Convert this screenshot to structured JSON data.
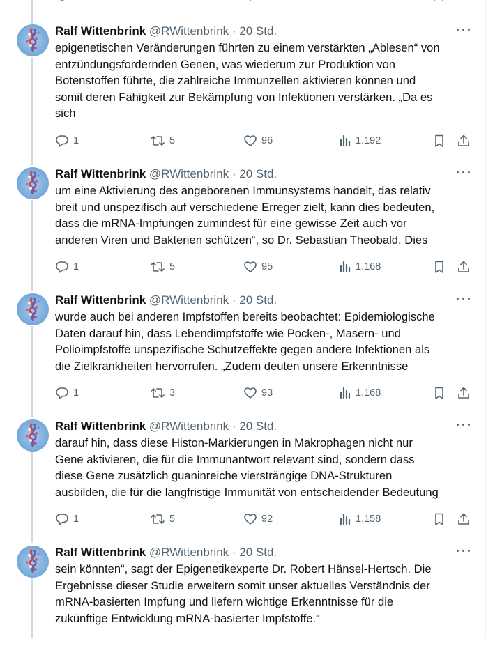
{
  "tweets": [
    {
      "author": "Ralf Wittenbrink",
      "handle": "@RWittenbrink",
      "time": "· 20 Std.",
      "lines": [
        "epigenetischen Veränderungen führten zu einem verstärkten „Ablesen“ von",
        "entzündungsfordernden Genen, was wiederum zur Produktion von",
        "Botenstoffen führte, die zahlreiche Immunzellen aktivieren können und",
        "somit deren Fähigkeit zur Bekämpfung von Infektionen verstärken. „Da es",
        "sich"
      ],
      "replies": "1",
      "reposts": "5",
      "likes": "96",
      "views": "1.192"
    },
    {
      "author": "Ralf Wittenbrink",
      "handle": "@RWittenbrink",
      "time": "· 20 Std.",
      "lines": [
        "um eine Aktivierung des angeborenen Immunsystems handelt, das relativ",
        "breit und unspezifisch auf verschiedene Erreger zielt, kann dies bedeuten,",
        "dass die mRNA-Impfungen zumindest für eine gewisse Zeit auch vor",
        "anderen Viren und Bakterien schützen“, so Dr. Sebastian Theobald. Dies"
      ],
      "replies": "1",
      "reposts": "5",
      "likes": "95",
      "views": "1.168"
    },
    {
      "author": "Ralf Wittenbrink",
      "handle": "@RWittenbrink",
      "time": "· 20 Std.",
      "lines": [
        "wurde auch bei anderen Impfstoffen bereits beobachtet: Epidemiologische",
        "Daten darauf hin, dass Lebendimpfstoffe wie Pocken-, Masern- und",
        "Polioimpfstoffe unspezifische Schutzeffekte gegen andere Infektionen als",
        "die Zielkrankheiten hervorrufen. „Zudem deuten unsere Erkenntnisse"
      ],
      "replies": "1",
      "reposts": "3",
      "likes": "93",
      "views": "1.168"
    },
    {
      "author": "Ralf Wittenbrink",
      "handle": "@RWittenbrink",
      "time": "· 20 Std.",
      "lines": [
        "darauf hin, dass diese Histon-Markierungen in Makrophagen nicht nur",
        "Gene aktivieren, die für die Immunantwort relevant sind, sondern dass",
        "diese Gene zusätzlich guaninreiche viersträngige DNA-Strukturen",
        "ausbilden, die für die langfristige Immunität von entscheidender Bedeutung"
      ],
      "replies": "1",
      "reposts": "5",
      "likes": "92",
      "views": "1.158"
    },
    {
      "author": "Ralf Wittenbrink",
      "handle": "@RWittenbrink",
      "time": "· 20 Std.",
      "lines": [
        "sein könnten“, sagt der Epigenetikexperte Dr. Robert Hänsel-Hertsch. Die",
        "Ergebnisse dieser Studie erweitern somit unser aktuelles Verständnis der",
        "mRNA-basierten Impfung und liefern wichtige Erkenntnisse für die",
        "zukünftige Entwicklung mRNA-basierter Impfstoffe.“"
      ]
    }
  ],
  "icons": {
    "reply": "reply-icon",
    "repost": "repost-icon",
    "like": "like-icon",
    "views": "views-icon",
    "bookmark": "bookmark-icon",
    "share": "share-icon",
    "more": "more-icon"
  },
  "colors": {
    "text": "#0f1419",
    "muted": "#536471",
    "thread_line": "#cfd9de"
  }
}
